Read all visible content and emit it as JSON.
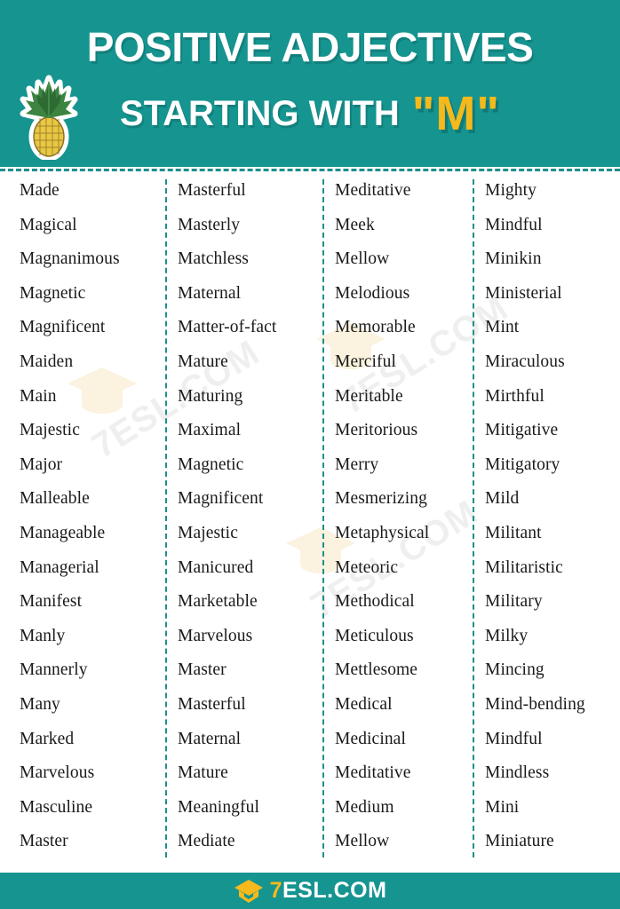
{
  "header": {
    "title_line1": "POSITIVE ADJECTIVES",
    "title_line2_prefix": "STARTING WITH",
    "title_line2_highlight": "\"M\"",
    "icon": "pineapple-sticker",
    "background_color": "#159490",
    "title_color": "#FFFFFF",
    "highlight_color": "#F5B91C"
  },
  "watermark": {
    "text": "7ESL.COM",
    "icon": "graduation-cap-icon"
  },
  "columns": [
    {
      "words": [
        "Made",
        "Magical",
        "Magnanimous",
        "Magnetic",
        "Magnificent",
        "Maiden",
        "Main",
        "Majestic",
        "Major",
        "Malleable",
        "Manageable",
        "Managerial",
        "Manifest",
        "Manly",
        "Mannerly",
        "Many",
        "Marked",
        "Marvelous",
        "Masculine",
        "Master"
      ]
    },
    {
      "words": [
        "Masterful",
        "Masterly",
        "Matchless",
        "Maternal",
        "Matter-of-fact",
        "Mature",
        "Maturing",
        "Maximal",
        "Magnetic",
        "Magnificent",
        "Majestic",
        "Manicured",
        "Marketable",
        "Marvelous",
        "Master",
        "Masterful",
        "Maternal",
        "Mature",
        "Meaningful",
        "Mediate"
      ]
    },
    {
      "words": [
        "Meditative",
        "Meek",
        "Mellow",
        "Melodious",
        "Memorable",
        "Merciful",
        "Meritable",
        "Meritorious",
        "Merry",
        "Mesmerizing",
        "Metaphysical",
        "Meteoric",
        "Methodical",
        "Meticulous",
        "Mettlesome",
        "Medical",
        "Medicinal",
        "Meditative",
        "Medium",
        "Mellow"
      ]
    },
    {
      "words": [
        "Mighty",
        "Mindful",
        "Minikin",
        "Ministerial",
        "Mint",
        "Miraculous",
        "Mirthful",
        "Mitigative",
        "Mitigatory",
        "Mild",
        "Militant",
        "Militaristic",
        "Military",
        "Milky",
        "Mincing",
        "Mind-bending",
        "Mindful",
        "Mindless",
        "Mini",
        "Miniature"
      ]
    }
  ],
  "footer": {
    "logo_seven": "7",
    "logo_rest": "ESL.COM",
    "logo_icon": "graduation-cap-icon",
    "background_color": "#159490"
  }
}
